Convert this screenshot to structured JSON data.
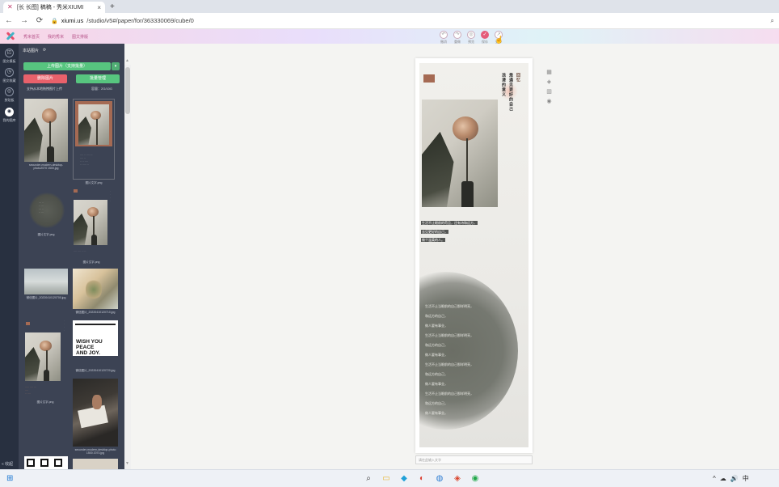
{
  "browser": {
    "tab_title": "[长 长图] 稿稿 - 秀米XIUMI",
    "url_host": "xiumi.us",
    "url_path": "/studio/v5#/paper/for/363330069/cube/0"
  },
  "app": {
    "nav": [
      "秀米首页",
      "我的秀米",
      "图文排版"
    ],
    "tools": [
      {
        "icon": "↶",
        "label": "撤消"
      },
      {
        "icon": "↷",
        "label": "重做"
      },
      {
        "icon": "◎",
        "label": "预览"
      },
      {
        "icon": "✓",
        "label": "保存"
      },
      {
        "icon": "↗",
        "label": "更多"
      }
    ]
  },
  "rail": [
    {
      "icon": "◰",
      "label": "图文模板"
    },
    {
      "icon": "◷",
      "label": "图文收藏"
    },
    {
      "icon": "◎",
      "label": "剪贴板"
    },
    {
      "icon": "◉",
      "label": "我的图库"
    }
  ],
  "rail_collapse": "« 收起",
  "panel": {
    "title": "本站图片",
    "refresh": "⟳",
    "upload": "上传图片（支持批量）",
    "upload_arrow": "▾",
    "delete": "删除图片",
    "manage": "批量管理",
    "note": "支持从本地拖拽图片上传",
    "capacity": "容量：2G/10G",
    "thumbs": [
      {
        "caption": "secunder-modern-desktop-photo2070 1500.jpg"
      },
      {
        "caption": "图片文字.png"
      },
      {
        "caption": "图片文字.png"
      },
      {
        "caption": "图片文字.png"
      },
      {
        "caption": "微信图片_20220410120700.jpg"
      },
      {
        "caption": "微信图片_20220410120710.jpg"
      },
      {
        "caption": "微信图片_20220410120720.jpg"
      },
      {
        "caption": "图片文字.png"
      },
      {
        "caption": "secunder-modern-desktop-photo 1500 2070.jpg"
      }
    ],
    "wish": {
      "line1": "WISH YOU",
      "line2": "PEACE",
      "line3": "AND JOY."
    }
  },
  "canvas": {
    "title_col1": "浪漫的意义",
    "title_col2": "是遇见更好的自己",
    "title_col3": "回忆",
    "dark_lines": [
      "生活不止眼前的苟且，还有诗和远方，",
      "去见更好的自己，",
      "做个温柔的人。"
    ],
    "blob_lines": [
      "生活不止当眼前的自己那样明亮，",
      "和远方的自己，",
      "做人要有事业，",
      "生活不止当眼前的自己那样明亮，",
      "和远方的自己，",
      "做人要有事业，",
      "生活不止当眼前的自己那样明亮，",
      "和远方的自己，",
      "做人要有事业，",
      "生活不止当眼前的自己那样明亮，",
      "和远方的自己，",
      "做人要有事业。"
    ],
    "caption_placeholder": "请在此输入文字",
    "side_tools": [
      "▦",
      "◈",
      "▥",
      "◉"
    ]
  },
  "taskbar": {
    "start": "⊞",
    "apps": [
      "⌕",
      "▭",
      "◆",
      "◐",
      "◍",
      "◈",
      "◉"
    ],
    "tray": [
      "^",
      "☁",
      "🔊",
      "中"
    ]
  }
}
